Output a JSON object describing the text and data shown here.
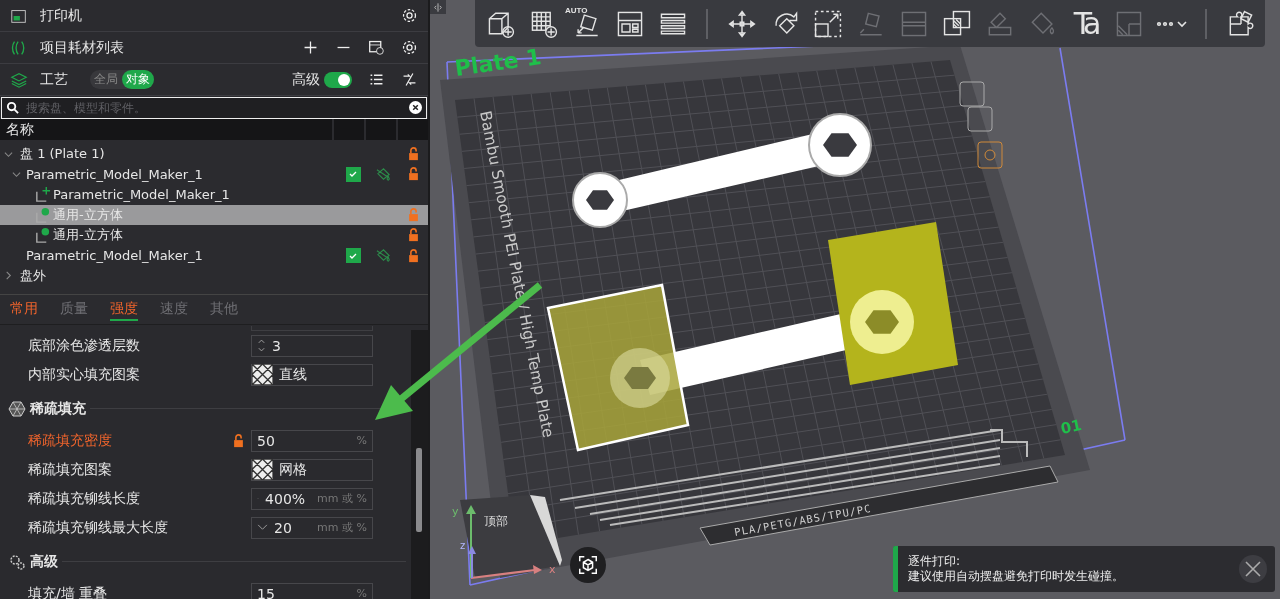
{
  "sidebar": {
    "printer": {
      "title": "打印机"
    },
    "filaments": {
      "title": "项目耗材列表"
    },
    "process": {
      "title": "工艺",
      "scope": [
        {
          "label": "全局",
          "selected": false
        },
        {
          "label": "对象",
          "selected": true
        }
      ],
      "advanced": {
        "label": "高级",
        "on": true
      }
    },
    "search": {
      "placeholder": "搜索盘、模型和零件。"
    },
    "object_list": {
      "columns": [
        "名称"
      ],
      "items": [
        {
          "kind": "plate",
          "label": "盘 1 (Plate 1)",
          "expanded": true,
          "locked": false,
          "selected": false,
          "children": [
            {
              "kind": "object",
              "label": "Parametric_Model_Maker_1",
              "expanded": true,
              "printable": true,
              "locked": false,
              "selected": false,
              "children": [
                {
                  "kind": "part",
                  "label": "Parametric_Model_Maker_1",
                  "selected": false
                },
                {
                  "kind": "modifier",
                  "label": "通用-立方体",
                  "locked": false,
                  "selected": true
                },
                {
                  "kind": "modifier",
                  "label": "通用-立方体",
                  "locked": false,
                  "selected": false
                }
              ]
            },
            {
              "kind": "object",
              "label": "Parametric_Model_Maker_1",
              "printable": true,
              "locked": false,
              "selected": false
            }
          ]
        },
        {
          "kind": "group",
          "label": "盘外",
          "expanded": false,
          "selected": false
        }
      ]
    },
    "tabs": [
      {
        "label": "常用",
        "selected": false,
        "modified": true
      },
      {
        "label": "质量",
        "selected": false,
        "modified": false
      },
      {
        "label": "强度",
        "selected": true,
        "modified": true
      },
      {
        "label": "速度",
        "selected": false,
        "modified": false
      },
      {
        "label": "其他",
        "selected": false,
        "modified": false
      }
    ],
    "settings": [
      {
        "kind": "spin",
        "label": "底部涂色渗透层数",
        "value": "3"
      },
      {
        "kind": "pattern",
        "label": "内部实心填充图案",
        "value": "直线"
      },
      {
        "kind": "section",
        "label": "稀疏填充"
      },
      {
        "kind": "field",
        "label": "稀疏填充密度",
        "value": "50",
        "unit": "%",
        "modified": true,
        "locked": false
      },
      {
        "kind": "pattern",
        "label": "稀疏填充图案",
        "value": "网格"
      },
      {
        "kind": "dropdown",
        "label": "稀疏填充铆线长度",
        "value": "400%",
        "unit": "mm 或 %"
      },
      {
        "kind": "dropdown",
        "label": "稀疏填充铆线最大长度",
        "value": "20",
        "unit": "mm 或 %"
      },
      {
        "kind": "section",
        "label": "高级"
      },
      {
        "kind": "field",
        "label": "填充/墙 重叠",
        "value": "15",
        "unit": "%"
      }
    ]
  },
  "viewport": {
    "toolbar": [
      {
        "kind": "add-cube",
        "disabled": false
      },
      {
        "kind": "add-plate",
        "disabled": false
      },
      {
        "kind": "auto-orient",
        "label": "AUTO",
        "disabled": false
      },
      {
        "kind": "arrange",
        "disabled": false
      },
      {
        "kind": "layers",
        "disabled": false
      },
      {
        "kind": "move",
        "disabled": false
      },
      {
        "kind": "rotate",
        "disabled": false
      },
      {
        "kind": "scale",
        "disabled": false
      },
      {
        "kind": "lay-flat",
        "disabled": true
      },
      {
        "kind": "split",
        "disabled": true
      },
      {
        "kind": "boolean",
        "disabled": false
      },
      {
        "kind": "cut",
        "disabled": true
      },
      {
        "kind": "paint",
        "disabled": true
      },
      {
        "kind": "text",
        "label": "Ta",
        "disabled": false
      },
      {
        "kind": "seam",
        "disabled": true
      },
      {
        "kind": "more",
        "disabled": false
      },
      {
        "kind": "assembly",
        "disabled": false
      }
    ],
    "plate_label": "Plate 1",
    "plate_type": "Bambu Smooth PEI Plate / High Temp Plate",
    "plate_number": "01",
    "filament_label": "PLA/PETG/ABS/TPU/PC",
    "view_cube": {
      "face": "顶部"
    },
    "axes": [
      "x",
      "y",
      "z"
    ],
    "notification": {
      "title": "逐件打印:",
      "message": "建议使用自动摆盘避免打印时发生碰撞。"
    }
  }
}
